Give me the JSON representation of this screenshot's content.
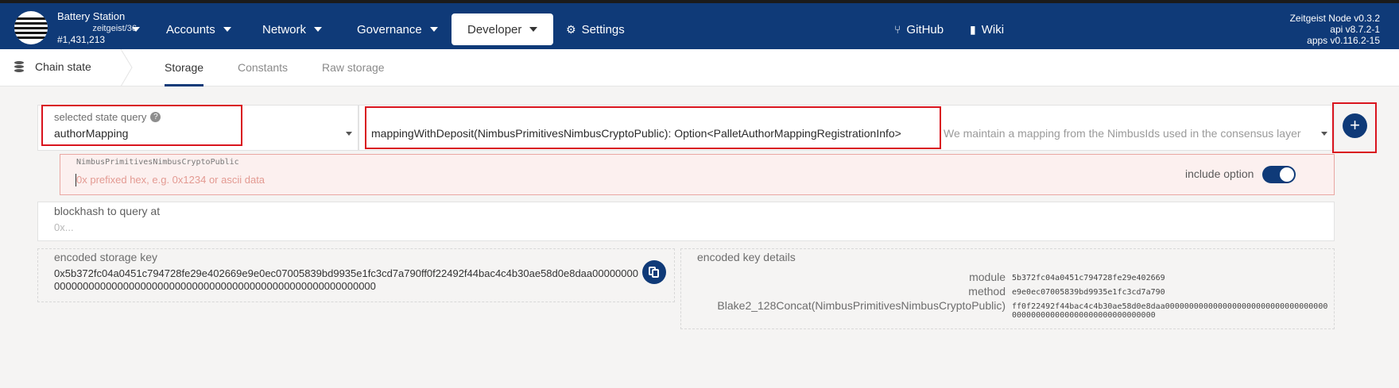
{
  "chain": {
    "name": "Battery Station",
    "spec": "zeitgeist/36",
    "block": "#1,431,213"
  },
  "nav": {
    "accounts": "Accounts",
    "network": "Network",
    "governance": "Governance",
    "developer": "Developer",
    "settings": "Settings",
    "github": "GitHub",
    "wiki": "Wiki"
  },
  "node": {
    "name": "Zeitgeist Node v0.3.2",
    "api": "api v8.7.2-1",
    "apps": "apps v0.116.2-15"
  },
  "subnav": {
    "title": "Chain state",
    "tabs": [
      "Storage",
      "Constants",
      "Raw storage"
    ],
    "active_tab": "Storage"
  },
  "query": {
    "label": "selected state query",
    "module": "authorMapping",
    "method": "mappingWithDeposit(NimbusPrimitivesNimbusCryptoPublic): Option<PalletAuthorMappingRegistrationInfo>",
    "description": "We maintain a mapping from the NimbusIds used in the consensus layer"
  },
  "param": {
    "label": "NimbusPrimitivesNimbusCryptoPublic",
    "placeholder": "0x prefixed hex, e.g. 0x1234 or ascii data",
    "include_option": "include option",
    "include_option_on": true
  },
  "blockhash": {
    "label": "blockhash to query at",
    "placeholder": "0x..."
  },
  "encoded_key": {
    "label": "encoded storage key",
    "value": "0x5b372fc04a0451c794728fe29e402669e9e0ec07005839bd9935e1fc3cd7a790ff0f22492f44bac4c4b30ae58d0e8daa0000000000000000000000000000000000000000000000000000000000000000"
  },
  "key_details": {
    "label": "encoded key details",
    "rows": [
      {
        "key": "module",
        "value": "5b372fc04a0451c794728fe29e402669"
      },
      {
        "key": "method",
        "value": "e9e0ec07005839bd9935e1fc3cd7a790"
      },
      {
        "key": "Blake2_128Concat(NimbusPrimitivesNimbusCryptoPublic)",
        "value": "ff0f22492f44bac4c4b30ae58d0e8daa0000000000000000000000000000000000000000000000000000000000000000"
      }
    ]
  },
  "icons": {
    "logo": "zeitgeist-logo",
    "settings": "gear-icon",
    "github": "branch-icon",
    "wiki": "book-icon",
    "subnav": "database-icon",
    "add": "plus-icon",
    "copy": "copy-icon",
    "help": "question-icon"
  },
  "colors": {
    "nav_bg": "#0f3a78",
    "highlight": "#d9141e",
    "param_bg": "#fcf0ef"
  }
}
